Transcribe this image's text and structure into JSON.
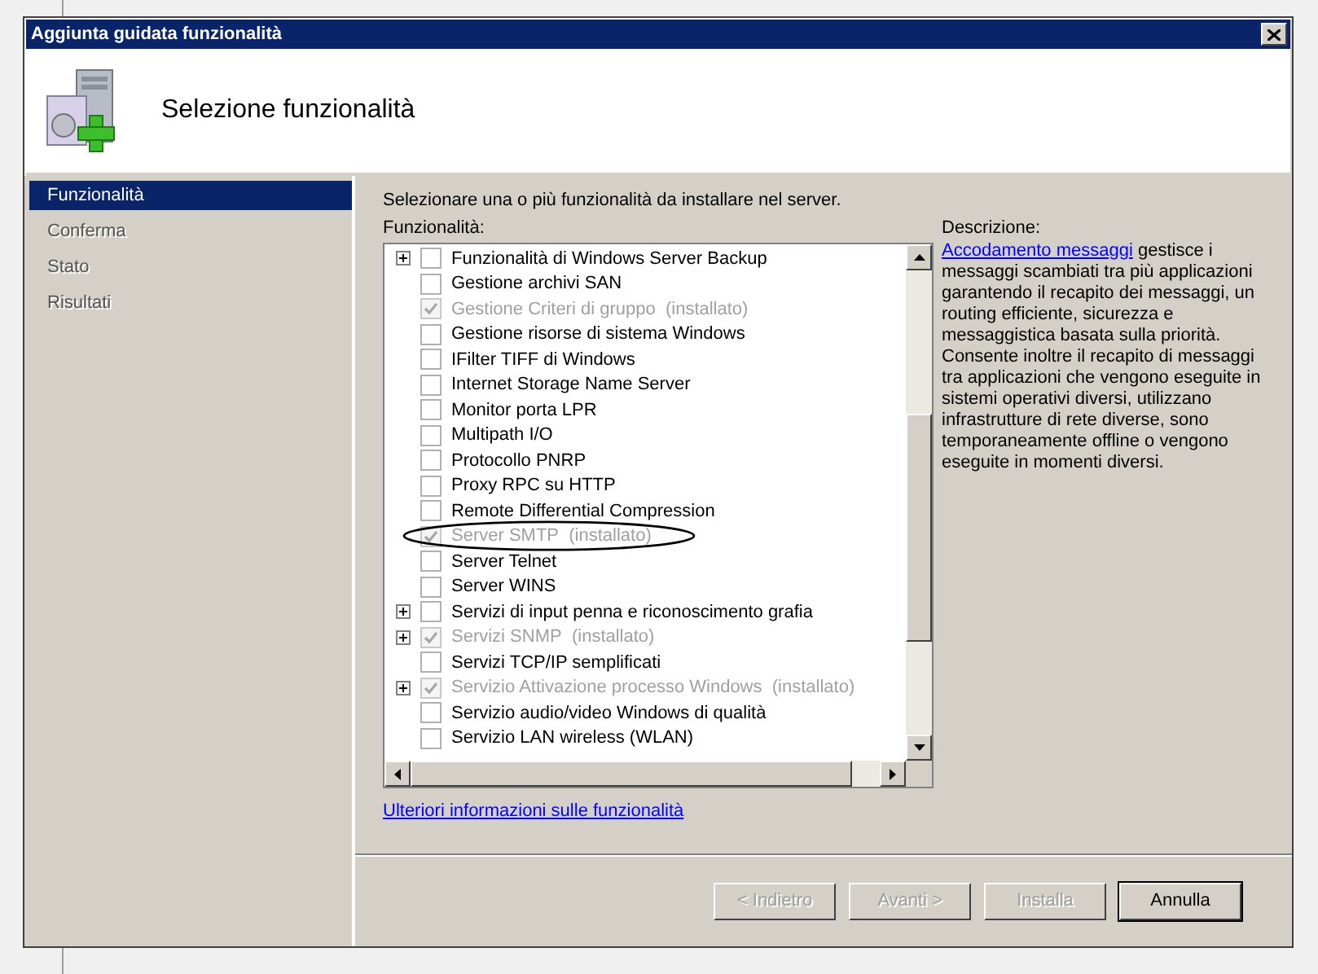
{
  "window": {
    "title": "Aggiunta guidata funzionalità"
  },
  "header": {
    "title": "Selezione funzionalità"
  },
  "sidebar": {
    "items": [
      {
        "label": "Funzionalità",
        "selected": true
      },
      {
        "label": "Conferma",
        "selected": false
      },
      {
        "label": "Stato",
        "selected": false
      },
      {
        "label": "Risultati",
        "selected": false
      }
    ]
  },
  "instructions": "Selezionare una o più funzionalità da installare nel server.",
  "features_label": "Funzionalità:",
  "features": [
    {
      "label": "Funzionalità di Windows Server Backup",
      "expandable": true,
      "checked": false,
      "disabled": false
    },
    {
      "label": "Gestione archivi SAN",
      "expandable": false,
      "checked": false,
      "disabled": false
    },
    {
      "label": "Gestione Criteri di gruppo",
      "note": "(installato)",
      "expandable": false,
      "checked": true,
      "disabled": true
    },
    {
      "label": "Gestione risorse di sistema Windows",
      "expandable": false,
      "checked": false,
      "disabled": false
    },
    {
      "label": "IFilter TIFF di Windows",
      "expandable": false,
      "checked": false,
      "disabled": false
    },
    {
      "label": "Internet Storage Name Server",
      "expandable": false,
      "checked": false,
      "disabled": false
    },
    {
      "label": "Monitor porta LPR",
      "expandable": false,
      "checked": false,
      "disabled": false
    },
    {
      "label": "Multipath I/O",
      "expandable": false,
      "checked": false,
      "disabled": false
    },
    {
      "label": "Protocollo PNRP",
      "expandable": false,
      "checked": false,
      "disabled": false
    },
    {
      "label": "Proxy RPC su HTTP",
      "expandable": false,
      "checked": false,
      "disabled": false
    },
    {
      "label": "Remote Differential Compression",
      "expandable": false,
      "checked": false,
      "disabled": false
    },
    {
      "label": "Server SMTP",
      "note": "(installato)",
      "expandable": false,
      "checked": true,
      "disabled": true
    },
    {
      "label": "Server Telnet",
      "expandable": false,
      "checked": false,
      "disabled": false
    },
    {
      "label": "Server WINS",
      "expandable": false,
      "checked": false,
      "disabled": false
    },
    {
      "label": "Servizi di input penna e riconoscimento grafia",
      "expandable": true,
      "checked": false,
      "disabled": false
    },
    {
      "label": "Servizi SNMP",
      "note": "(installato)",
      "expandable": true,
      "checked": true,
      "disabled": true
    },
    {
      "label": "Servizi TCP/IP semplificati",
      "expandable": false,
      "checked": false,
      "disabled": false
    },
    {
      "label": "Servizio Attivazione processo Windows",
      "note": "(installato)",
      "expandable": true,
      "checked": true,
      "disabled": true
    },
    {
      "label": "Servizio audio/video Windows di qualità",
      "expandable": false,
      "checked": false,
      "disabled": false
    },
    {
      "label": "Servizio LAN wireless (WLAN)",
      "expandable": false,
      "checked": false,
      "disabled": false
    }
  ],
  "more_info_link": "Ulteriori informazioni sulle funzionalità",
  "description": {
    "label": "Descrizione:",
    "link": "Accodamento messaggi",
    "text": "gestisce i messaggi scambiati tra più applicazioni garantendo il recapito dei messaggi, un routing efficiente, sicurezza e messaggistica basata sulla priorità. Consente inoltre il recapito di messaggi tra applicazioni che vengono eseguite in sistemi operativi diversi, utilizzano infrastrutture di rete diverse, sono temporaneamente offline o vengono eseguite in momenti diversi."
  },
  "buttons": [
    {
      "label": "< Indietro",
      "disabled": true,
      "default": false
    },
    {
      "label": "Avanti >",
      "disabled": true,
      "default": false
    },
    {
      "label": "Installa",
      "disabled": true,
      "default": false
    },
    {
      "label": "Annulla",
      "disabled": false,
      "default": true
    }
  ]
}
